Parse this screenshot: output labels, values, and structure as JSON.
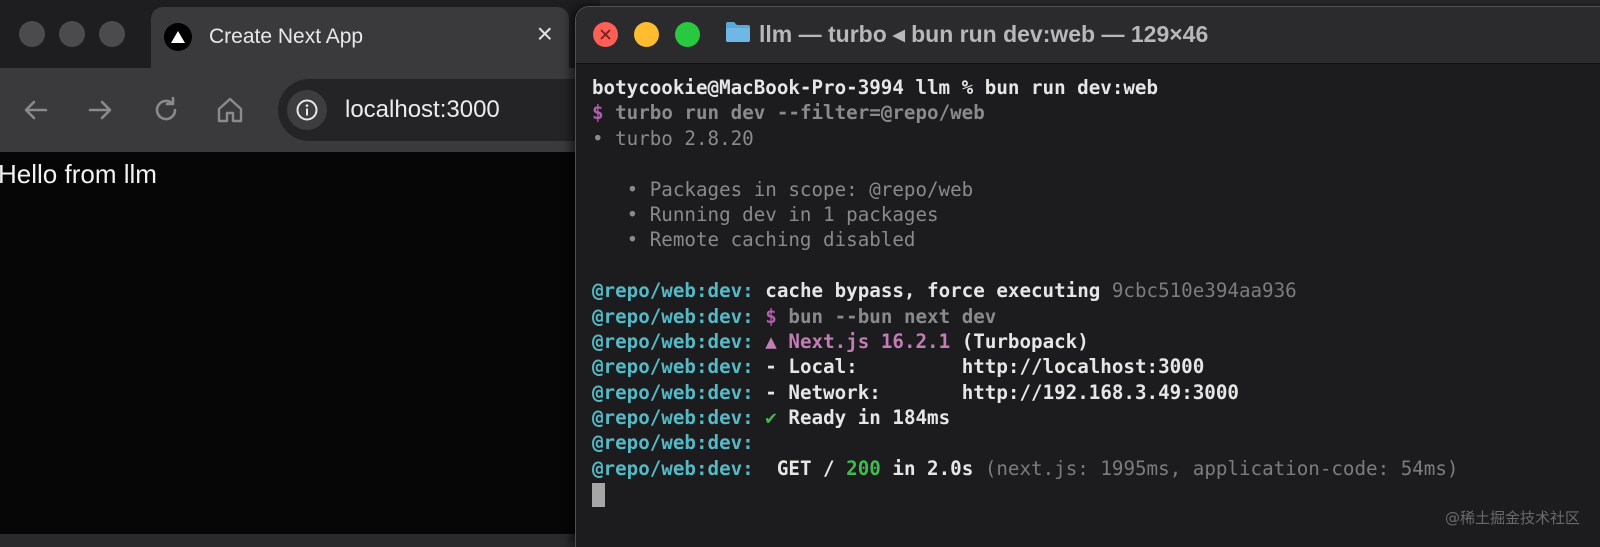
{
  "browser": {
    "tab_title": "Create Next App",
    "tab_close": "×",
    "url": "localhost:3000",
    "page_text": "Hello from llm"
  },
  "terminal": {
    "title": "llm — turbo ◂ bun run dev:web — 129×46",
    "lines": {
      "l1_prompt": "botycookie@MacBook-Pro-3994 llm % bun run dev:web",
      "l2_dollar": "$",
      "l2_cmd": "turbo run dev --filter=@repo/web",
      "l3": "• turbo 2.8.20",
      "l5": "   • Packages in scope: @repo/web",
      "l6": "   • Running dev in 1 packages",
      "l7": "   • Remote caching disabled",
      "prefix": "@repo/web:dev:",
      "l9_text": "cache bypass, force executing",
      "l9_hash": "9cbc510e394aa936",
      "l10_dollar": "$",
      "l10_cmd": "bun --bun next dev",
      "l11_triangle": "▲",
      "l11_next": "Next.js 16.2.1",
      "l11_rest": "(Turbopack)",
      "l12_label": "- Local:",
      "l12_url": "http://localhost:3000",
      "l13_label": "- Network:",
      "l13_url": "http://192.168.3.49:3000",
      "l14_check": "✔",
      "l14_text": "Ready in 184ms",
      "l16_get": " GET /",
      "l16_status": "200",
      "l16_time": "in 2.0s",
      "l16_detail": "(next.js: 1995ms, application-code: 54ms)"
    }
  },
  "watermark": "@稀土掘金技术社区",
  "colors": {
    "cyan": "#56b9c6",
    "green": "#3fbb4f",
    "purple": "#b15eb0",
    "traffic_red": "#fe5f57",
    "traffic_yellow": "#febc2e",
    "traffic_green": "#28c840"
  }
}
